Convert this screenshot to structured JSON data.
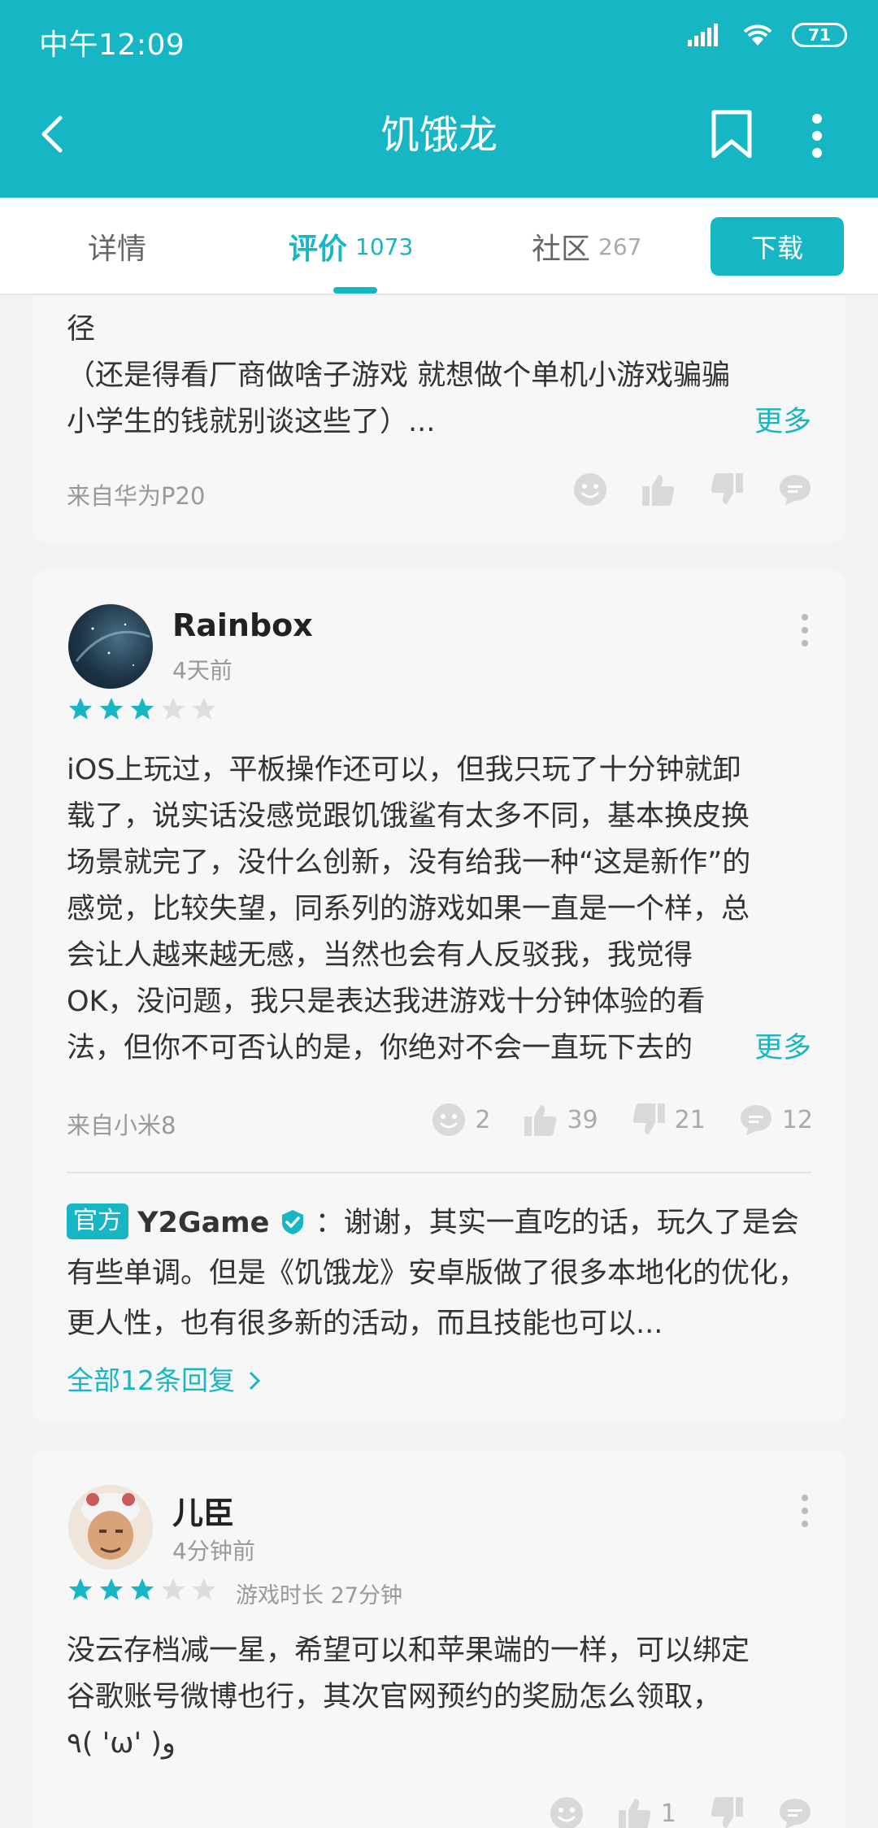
{
  "status_bar": {
    "time": "中午12:09",
    "battery": "71"
  },
  "header": {
    "title": "饥饿龙"
  },
  "tabs": [
    {
      "label": "详情",
      "count": ""
    },
    {
      "label": "评价",
      "count": "1073"
    },
    {
      "label": "社区",
      "count": "267"
    }
  ],
  "download_label": "下载",
  "review1": {
    "text_line1": "径",
    "text_line2": "（还是得看厂商做啥子游戏 就想做个单机小游戏骗骗",
    "text_line3": "小学生的钱就别谈这些了）...",
    "more": "更多",
    "device": "来自华为P20"
  },
  "review2": {
    "user": "Rainbox",
    "time": "4天前",
    "rating": 3,
    "lines": [
      "iOS上玩过，平板操作还可以，但我只玩了十分钟就卸",
      "载了，说实话没感觉跟饥饿鲨有太多不同，基本换皮换",
      "场景就完了，没什么创新，没有给我一种“这是新作”的",
      "感觉，比较失望，同系列的游戏如果一直是一个样，总",
      "会让人越来越无感，当然也会有人反驳我，我觉得",
      "OK，没问题，我只是表达我进游戏十分钟体验的看",
      "法，但你不可否认的是，你绝对不会一直玩下去的"
    ],
    "more": "更多",
    "device": "来自小米8",
    "smile": "2",
    "likes": "39",
    "dislikes": "21",
    "comments": "12",
    "reply": {
      "badge": "官方",
      "name": "Y2Game",
      "text": "：谢谢，其实一直吃的话，玩久了是会有些单调。但是《饥饿龙》安卓版做了很多本地化的优化，更人性，也有很多新的活动，而且技能也可以...",
      "all": "全部12条回复"
    }
  },
  "review3": {
    "user": "儿臣",
    "time": "4分钟前",
    "rating": 3,
    "playtime": "游戏时长 27分钟",
    "lines": [
      "没云存档减一星，希望可以和苹果端的一样，可以绑定",
      "谷歌账号微博也行，其次官网预约的奖励怎么领取，",
      "٩( 'ω' )و"
    ],
    "likes": "1"
  },
  "colors": {
    "accent": "#16b6c4",
    "star_on": "#16b6c4",
    "star_off": "#dddddd"
  }
}
